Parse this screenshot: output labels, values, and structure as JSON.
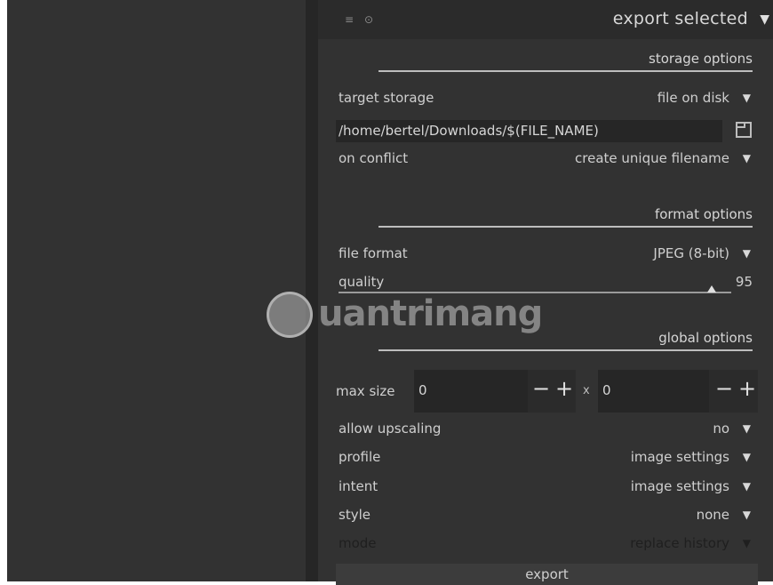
{
  "header": {
    "menu_icon": "≡",
    "reset_icon": "⊙",
    "title": "export selected",
    "collapse_icon": "▼"
  },
  "storage": {
    "section_title": "storage options",
    "target_storage_label": "target storage",
    "target_storage_value": "file on disk",
    "path_value": "/home/bertel/Downloads/$(FILE_NAME)",
    "conflict_label": "on conflict",
    "conflict_value": "create unique filename"
  },
  "format": {
    "section_title": "format options",
    "file_format_label": "file format",
    "file_format_value": "JPEG (8-bit)",
    "quality_label": "quality",
    "quality_value": "95"
  },
  "global": {
    "section_title": "global options",
    "max_size_label": "max size",
    "width_value": "0",
    "height_value": "0",
    "times_symbol": "x",
    "minus_symbol": "−",
    "plus_symbol": "+",
    "upscaling_label": "allow upscaling",
    "upscaling_value": "no",
    "profile_label": "profile",
    "profile_value": "image settings",
    "intent_label": "intent",
    "intent_value": "image settings",
    "style_label": "style",
    "style_value": "none",
    "mode_label": "mode",
    "mode_value": "replace history"
  },
  "dropdown_arrow": "▼",
  "export_button": "export",
  "watermark": {
    "text": "uantrimang"
  },
  "colors": {
    "panel_bg": "#323232",
    "field_bg": "#262626",
    "text": "#cfcfcf"
  }
}
